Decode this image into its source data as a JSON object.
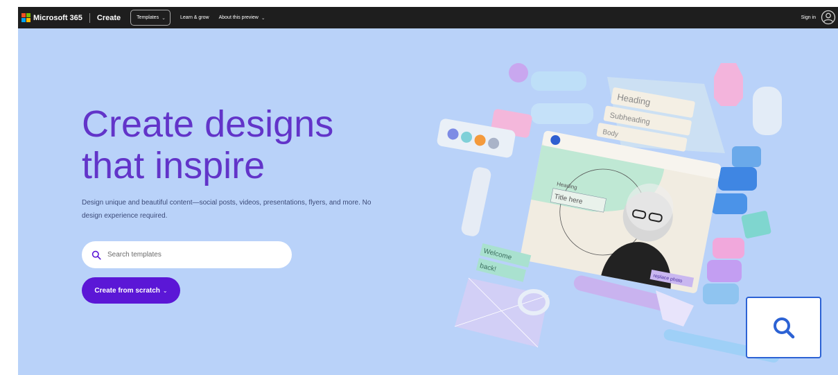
{
  "header": {
    "brand": "Microsoft 365",
    "app_name": "Create",
    "nav": {
      "templates": "Templates",
      "learn": "Learn & grow",
      "about": "About this preview"
    },
    "sign_in": "Sign in"
  },
  "hero": {
    "headline": "Create designs that inspire",
    "subtext": "Design unique and beautiful content—social posts, videos, presentations, flyers, and more. No design experience required.",
    "search_placeholder": "Search templates",
    "create_button": "Create from scratch"
  },
  "illustration": {
    "card_title": "Title here",
    "card_heading": "Heading",
    "photo_tag": "replace photo",
    "welcome_tag": "Welcome",
    "back_tag": "back!",
    "stack_labels": [
      "Heading",
      "Subheading",
      "Body"
    ]
  },
  "colors": {
    "header_bg": "#1e1e1e",
    "hero_bg": "#b9d2f9",
    "headline": "#6234c9",
    "button": "#5b17d6"
  },
  "icons": [
    "microsoft-logo-icon",
    "chevron-down-icon",
    "user-icon",
    "search-icon",
    "zoom-search-icon"
  ]
}
